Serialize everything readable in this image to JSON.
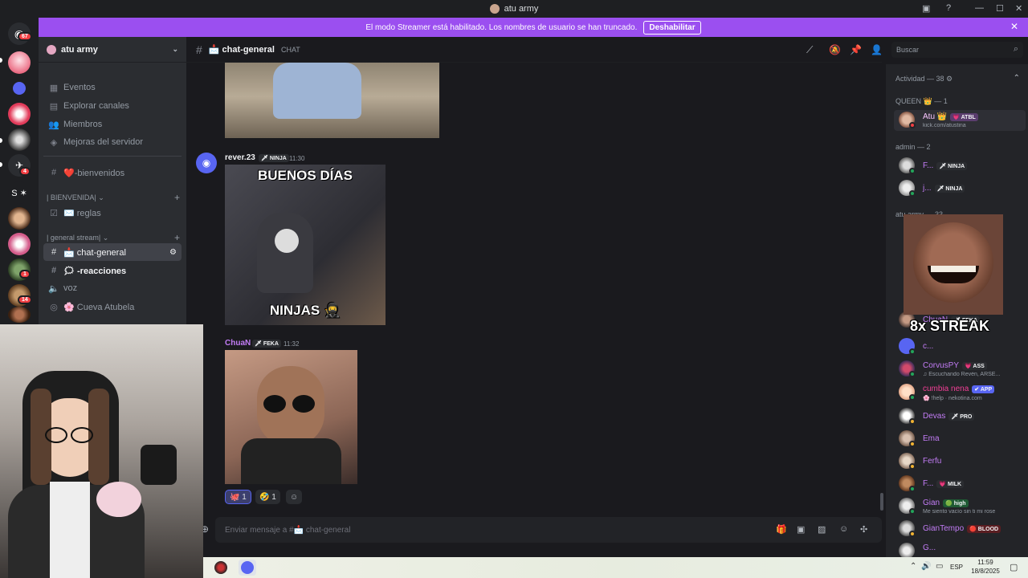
{
  "window": {
    "title": "atu army"
  },
  "banner": {
    "text": "El modo Streamer está habilitado. Los nombres de usuario se han truncado.",
    "button": "Deshabilitar"
  },
  "guilds": {
    "badges": [
      "67",
      "4",
      "1",
      "14"
    ]
  },
  "sidebar": {
    "server_name": "atu army",
    "items": [
      {
        "icon": "calendar-icon",
        "label": "Eventos"
      },
      {
        "icon": "compass-icon",
        "label": "Explorar canales"
      },
      {
        "icon": "members-icon",
        "label": "Miembros"
      },
      {
        "icon": "boost-icon",
        "label": "Mejoras del servidor"
      }
    ],
    "channels": [
      {
        "label": "❤️-bienvenidos"
      },
      {
        "label": "✉️ reglas"
      },
      {
        "label": "📩 chat-general"
      },
      {
        "label": "🗯 -reacciones"
      },
      {
        "label": "voz"
      },
      {
        "label": "🌸 Cueva Atubela"
      }
    ],
    "categories": [
      "| BIENVENIDA|",
      "| general stream|"
    ]
  },
  "channel_header": {
    "name": "📩 chat-general",
    "tag": "CHAT",
    "search_placeholder": "Buscar"
  },
  "messages": [
    {
      "user": "rever.23",
      "tag": "🗡 NINJA",
      "time": "11:30",
      "gif_top": "BUENOS DÍAS",
      "gif_bottom": "NINJAS 🥷"
    },
    {
      "user": "ChuaN",
      "tag": "🗡 FEKA",
      "time": "11:32"
    }
  ],
  "reactions": [
    {
      "emoji": "🐙",
      "count": "1"
    },
    {
      "emoji": "🤣",
      "count": "1"
    }
  ],
  "composer": {
    "placeholder": "Enviar mensaje a #📩 chat-general"
  },
  "members": {
    "activity": "Actividad — 38",
    "queen_header": "QUEEN 👑 — 1",
    "admin_header": "admin — 2",
    "army_header": "atu army — 33",
    "queen": [
      {
        "name": "Atu 👑",
        "tag": "💗 ATBL",
        "sub": "kick.com/atustina"
      }
    ],
    "admins": [
      {
        "name": "F...",
        "tag": "🗡 NINJA"
      },
      {
        "name": "j...",
        "tag": "🗡 NINJA"
      }
    ],
    "army": [
      {
        "name": "ChuaN",
        "tag": "🗡 FEKA",
        "sub": ""
      },
      {
        "name": "c...",
        "tag": "",
        "sub": ""
      },
      {
        "name": "CorvusPY",
        "tag": "💗 ASS",
        "sub": "♫ Escuchando Revén, ARSE..."
      },
      {
        "name": "cumbia nena",
        "tag": "✔ APP",
        "sub": "🌸 !help · nekotina.com"
      },
      {
        "name": "Devas",
        "tag": "🗡 PRO",
        "sub": ""
      },
      {
        "name": "Ema",
        "tag": "",
        "sub": ""
      },
      {
        "name": "Ferfu",
        "tag": "",
        "sub": ""
      },
      {
        "name": "F...",
        "tag": "💗 MILK",
        "sub": ""
      },
      {
        "name": "Gian",
        "tag": "🟢 high",
        "sub": "Me siento vacío sin ti mi rose"
      },
      {
        "name": "GianTempo",
        "tag": "🔴 BLOOD",
        "sub": ""
      },
      {
        "name": "G...",
        "tag": "",
        "sub": ""
      }
    ]
  },
  "overlay": {
    "streak": "8x STREAK"
  },
  "taskbar": {
    "lang": "ESP",
    "time": "11:59",
    "date": "18/8/2025"
  },
  "colors": {
    "accent": "#9b4ff0",
    "online": "#23a55a",
    "idle": "#f0b232",
    "link": "#c27cf5"
  }
}
